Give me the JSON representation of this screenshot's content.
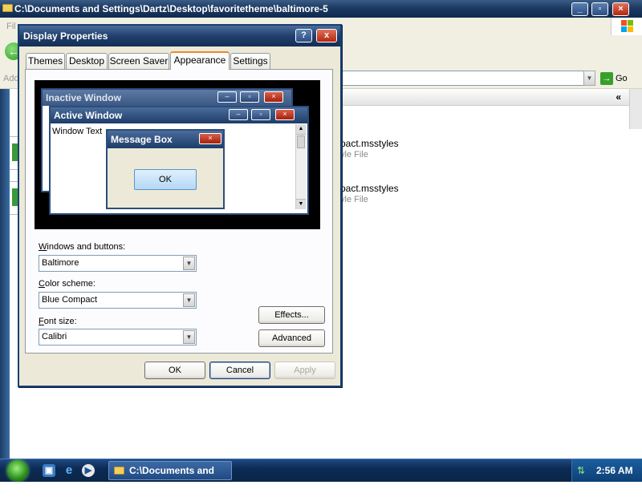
{
  "explorer": {
    "title": "C:\\Documents and Settings\\Dartz\\Desktop\\favoritetheme\\baltimore-5",
    "menu_file": "Fil",
    "address_label": "Add",
    "go_label": "Go",
    "files": [
      {
        "name": "pact.msstyles",
        "type": "yle File"
      },
      {
        "name": "pact.msstyles",
        "type": "yle File"
      }
    ]
  },
  "dialog": {
    "title": "Display Properties",
    "help_button": "?",
    "close_button": "x",
    "tabs": [
      {
        "label": "Themes",
        "active": false
      },
      {
        "label": "Desktop",
        "active": false
      },
      {
        "label": "Screen Saver",
        "active": false
      },
      {
        "label": "Appearance",
        "active": true
      },
      {
        "label": "Settings",
        "active": false
      }
    ],
    "preview": {
      "inactive_title": "Inactive Window",
      "active_title": "Active Window",
      "window_text": "Window Text",
      "message_title": "Message Box",
      "message_ok": "OK"
    },
    "windows_buttons": {
      "label": "Windows and buttons:",
      "hotkey": "W",
      "rest": "indows and buttons:",
      "value": "Baltimore"
    },
    "color_scheme": {
      "label": "Color scheme:",
      "hotkey": "C",
      "rest": "olor scheme:",
      "value": "Blue Compact"
    },
    "font_size": {
      "label": "Font size:",
      "hotkey": "F",
      "rest": "ont size:",
      "value": "Calibri"
    },
    "effects_button": "Effects...",
    "advanced_button": "Advanced",
    "ok_button": "OK",
    "cancel_button": "Cancel",
    "apply_button": "Apply"
  },
  "taskbar": {
    "task_label": "C:\\Documents and S...",
    "clock": "2:56 AM"
  },
  "colors": {
    "titlebar": "#1d3a62",
    "taskbar": "#0c2b55",
    "start_orb": "#2c8e1b",
    "close_red": "#b3280f",
    "tab_highlight": "#e68b2c"
  }
}
